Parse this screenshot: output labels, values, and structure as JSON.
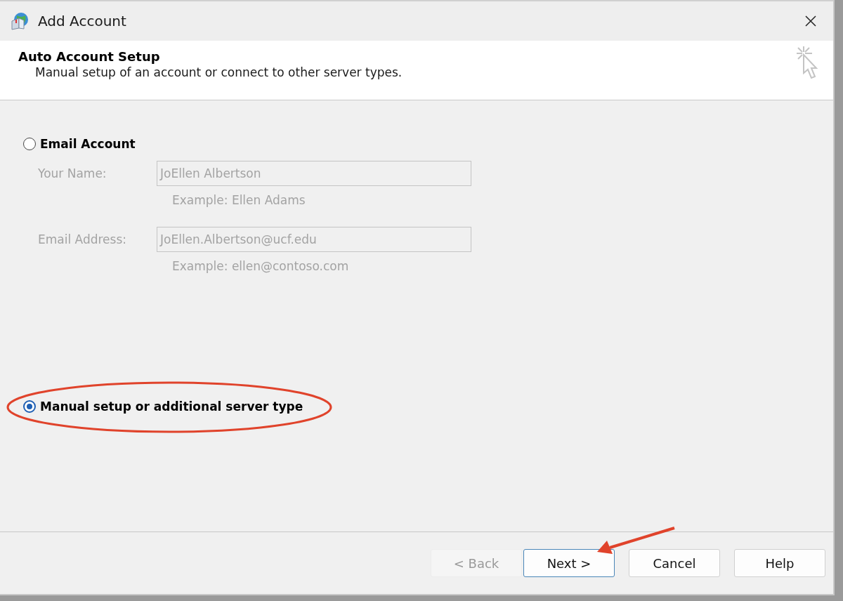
{
  "window": {
    "title": "Add Account"
  },
  "header": {
    "title": "Auto Account Setup",
    "subtitle": "Manual setup of an account or connect to other server types."
  },
  "options": [
    {
      "label": "Email Account",
      "selected": false
    },
    {
      "label": "Manual setup or additional server type",
      "selected": true
    }
  ],
  "email_form": {
    "disabled": true,
    "fields": [
      {
        "label": "Your Name:",
        "value": "JoEllen Albertson",
        "example": "Example: Ellen Adams"
      },
      {
        "label": "Email Address:",
        "value": "JoEllen.Albertson@ucf.edu",
        "example": "Example: ellen@contoso.com"
      }
    ]
  },
  "buttons": [
    {
      "label": "< Back",
      "disabled": true,
      "default": false
    },
    {
      "label": "Next >",
      "disabled": false,
      "default": true
    },
    {
      "label": "Cancel",
      "disabled": false,
      "default": false
    },
    {
      "label": "Help",
      "disabled": false,
      "default": false
    }
  ]
}
